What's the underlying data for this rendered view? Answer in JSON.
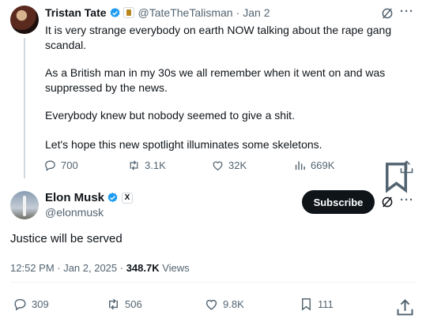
{
  "quoted_tweet": {
    "author_name": "Tristan Tate",
    "handle": "@TateTheTalisman",
    "separator": "·",
    "date": "Jan 2",
    "paragraphs": [
      "It is very strange everybody on earth NOW talking about the rape gang scandal.",
      "As a British man in my 30s we all remember when it went on and was suppressed by the news.",
      "Everybody knew but nobody seemed to give a shit.",
      "Let's hope this new spotlight illuminates some skeletons."
    ],
    "stats": {
      "replies": "700",
      "reposts": "3.1K",
      "likes": "32K",
      "views": "669K"
    }
  },
  "main_tweet": {
    "author_name": "Elon Musk",
    "handle": "@elonmusk",
    "subscribe_label": "Subscribe",
    "text": "Justice will be served",
    "time": "12:52 PM · Jan 2, 2025 · ",
    "views_count": "348.7K",
    "views_label": " Views",
    "stats": {
      "replies": "309",
      "reposts": "506",
      "likes": "9.8K",
      "bookmarks": "111"
    }
  },
  "icons": {
    "verified": "verified-badge-icon",
    "grok": "grok-icon",
    "more": "more-icon",
    "reply": "reply-icon",
    "repost": "repost-icon",
    "like": "like-icon",
    "views": "views-icon",
    "bookmark": "bookmark-icon",
    "share": "share-icon"
  },
  "colors": {
    "text": "#0f1419",
    "secondary": "#536471",
    "verified": "#1d9bf0",
    "subscribe_bg": "#0f1419"
  }
}
